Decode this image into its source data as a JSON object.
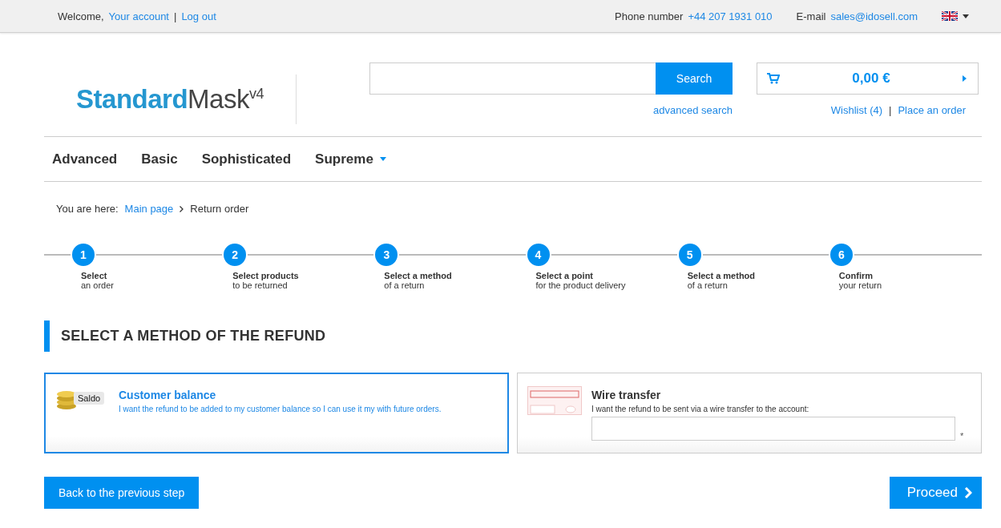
{
  "top_bar": {
    "welcome": "Welcome,",
    "account_link": "Your account",
    "separator": "|",
    "logout_link": "Log out",
    "phone_label": "Phone number",
    "phone": "+44 207 1931 010",
    "email_label": "E-mail",
    "email": "sales@idosell.com"
  },
  "logo": {
    "bold": "Standard",
    "light": "Mask",
    "sup": "v4"
  },
  "search": {
    "button": "Search",
    "advanced": "advanced search"
  },
  "cart": {
    "total": "0,00 €",
    "wishlist": "Wishlist (4)",
    "separator": "|",
    "place_order": "Place an order"
  },
  "menu": [
    {
      "label": "Advanced",
      "dropdown": false
    },
    {
      "label": "Basic",
      "dropdown": false
    },
    {
      "label": "Sophisticated",
      "dropdown": false
    },
    {
      "label": "Supreme",
      "dropdown": true
    }
  ],
  "breadcrumb": {
    "label": "You are here:",
    "items": [
      {
        "label": "Main page",
        "link": true
      },
      {
        "label": "Return order",
        "link": false
      }
    ]
  },
  "steps": [
    {
      "number": "1",
      "title": "Select",
      "subtitle": "an order"
    },
    {
      "number": "2",
      "title": "Select products",
      "subtitle": "to be returned"
    },
    {
      "number": "3",
      "title": "Select a method",
      "subtitle": "of a return"
    },
    {
      "number": "4",
      "title": "Select a point",
      "subtitle": "for the product delivery"
    },
    {
      "number": "5",
      "title": "Select a method",
      "subtitle": "of a return"
    },
    {
      "number": "6",
      "title": "Confirm",
      "subtitle": "your return"
    }
  ],
  "heading": "SELECT A METHOD OF THE REFUND",
  "options": [
    {
      "kind": "balance",
      "title": "Customer balance",
      "description": "I want the refund to be added to my customer balance so I can use it my with future orders.",
      "icon_label": "Saldo",
      "selected": true
    },
    {
      "kind": "transfer",
      "title": "Wire transfer",
      "description": "I want the refund to be sent via a wire transfer to the account:",
      "required_mark": "*",
      "selected": false
    }
  ],
  "buttons": {
    "back": "Back to the previous step",
    "proceed": "Proceed"
  }
}
